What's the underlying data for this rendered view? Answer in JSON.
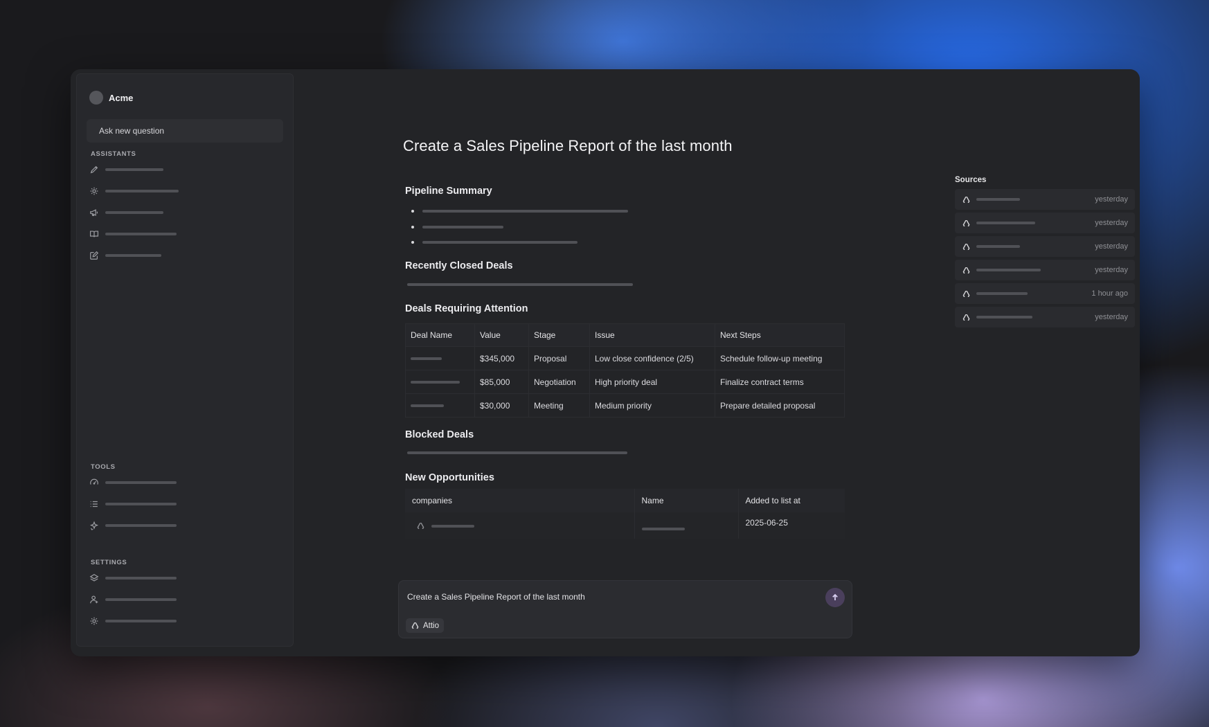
{
  "sidebar": {
    "workspace_name": "Acme",
    "ask_button_label": "Ask new question",
    "sections": {
      "assistants_label": "ASSISTANTS",
      "tools_label": "TOOLS",
      "settings_label": "SETTINGS"
    },
    "assistants_icons": [
      "pen-icon",
      "gear-icon",
      "megaphone-icon",
      "book-icon",
      "edit-icon"
    ],
    "tools_icons": [
      "gauge-icon",
      "list-icon",
      "sparkle-icon"
    ],
    "settings_icons": [
      "layers-icon",
      "user-add-icon",
      "gear-icon"
    ]
  },
  "report": {
    "title": "Create a Sales Pipeline Report of the last month",
    "pipeline_summary_heading": "Pipeline Summary",
    "recently_closed_heading": "Recently Closed Deals",
    "attention_heading": "Deals Requiring Attention",
    "blocked_heading": "Blocked Deals",
    "new_opps_heading": "New Opportunities",
    "attention_table": {
      "headers": [
        "Deal Name",
        "Value",
        "Stage",
        "Issue",
        "Next Steps"
      ],
      "rows": [
        {
          "value": "$345,000",
          "stage": "Proposal",
          "issue": "Low close confidence (2/5)",
          "next": "Schedule follow-up meeting"
        },
        {
          "value": "$85,000",
          "stage": "Negotiation",
          "issue": "High priority deal",
          "next": "Finalize contract terms"
        },
        {
          "value": "$30,000",
          "stage": "Meeting",
          "issue": "Medium priority",
          "next": "Prepare detailed proposal"
        }
      ]
    },
    "opps_table": {
      "headers": [
        "companies",
        "Name",
        "Added to list at"
      ],
      "rows": [
        {
          "added": "2025-06-25"
        }
      ]
    }
  },
  "sources": {
    "title": "Sources",
    "items": [
      {
        "when": "yesterday"
      },
      {
        "when": "yesterday"
      },
      {
        "when": "yesterday"
      },
      {
        "when": "yesterday"
      },
      {
        "when": "1 hour ago"
      },
      {
        "when": "yesterday"
      }
    ]
  },
  "composer": {
    "value": "Create a Sales Pipeline Report of the last month",
    "chip_label": "Attio"
  },
  "colors": {
    "accent_send": "#4a3f5c",
    "window_bg": "#232427"
  }
}
